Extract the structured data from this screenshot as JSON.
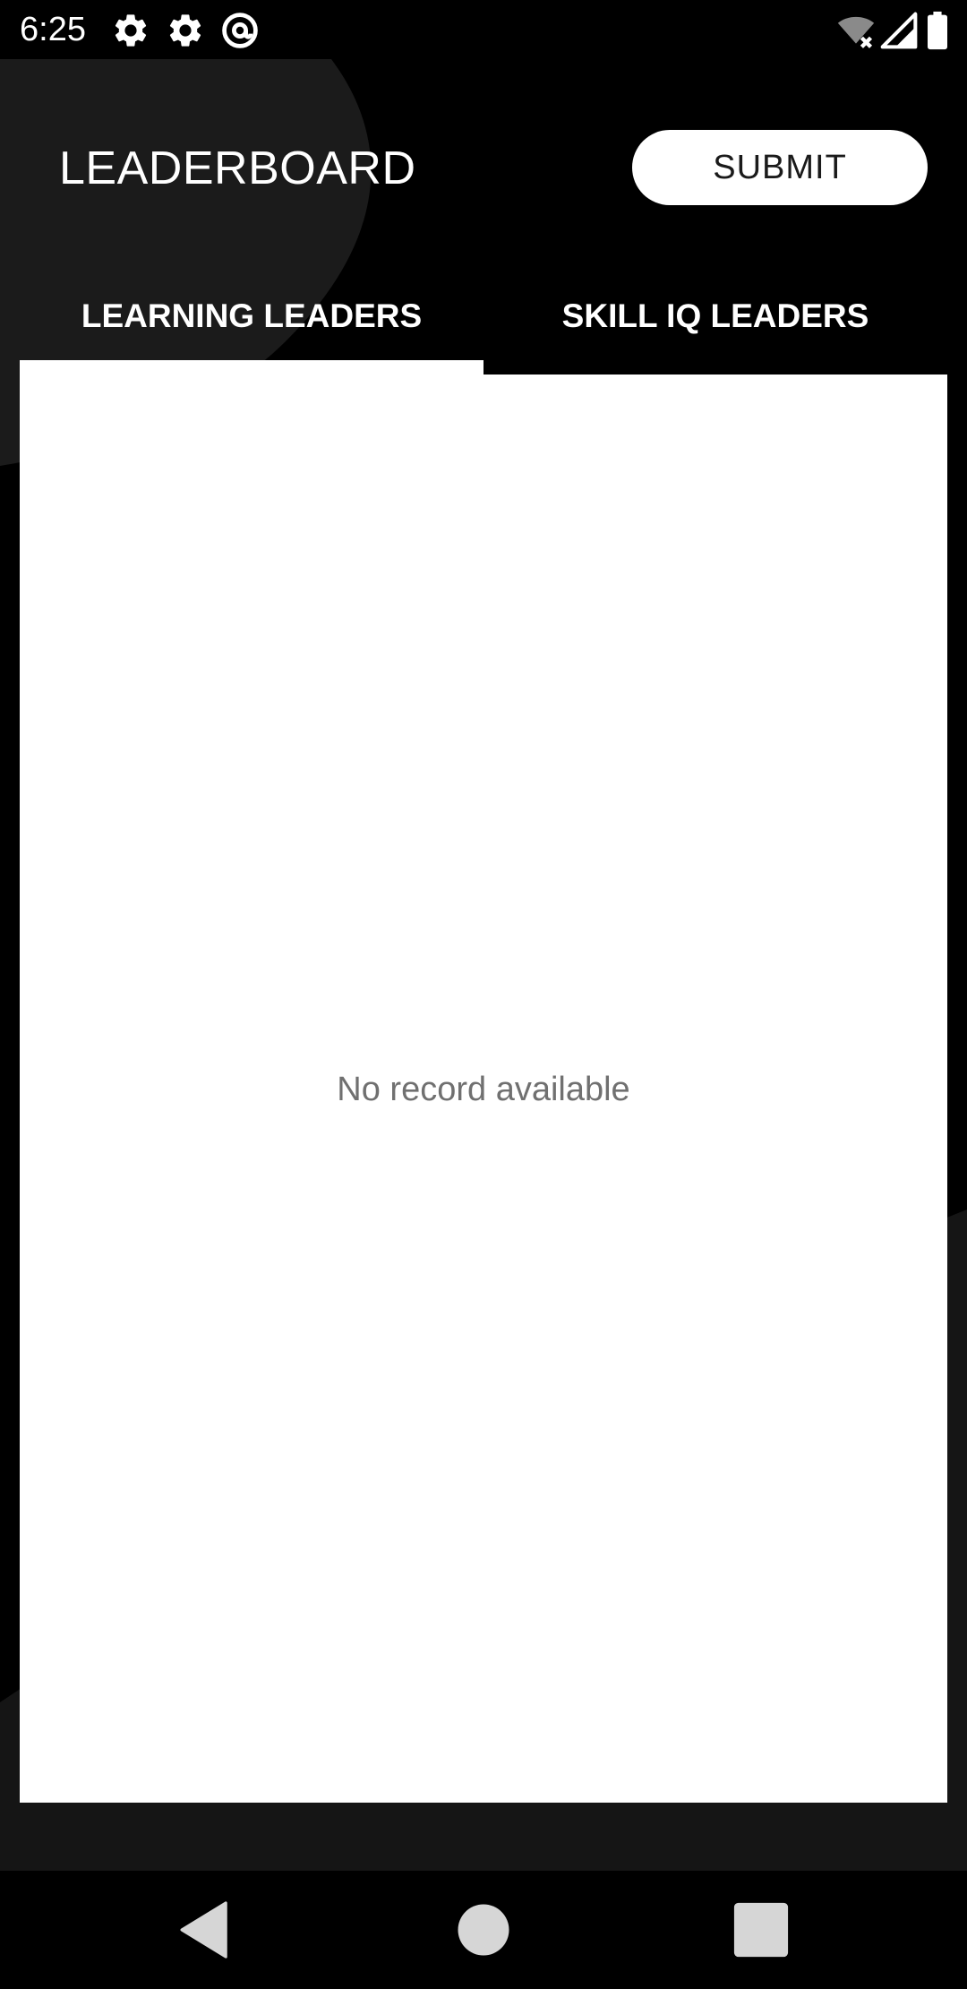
{
  "status_bar": {
    "time": "6:25",
    "icons_left": [
      "settings-icon",
      "settings-icon",
      "at-sign-icon"
    ],
    "icons_right": [
      "wifi-off-icon",
      "cellular-signal-icon",
      "battery-icon"
    ]
  },
  "header": {
    "title": "LEADERBOARD",
    "submit_label": "SUBMIT"
  },
  "tabs": [
    {
      "label": "LEARNING LEADERS",
      "selected": true
    },
    {
      "label": "SKILL IQ LEADERS",
      "selected": false
    }
  ],
  "content": {
    "empty_message": "No record available"
  },
  "nav_bar": {
    "buttons": [
      "back-icon",
      "home-icon",
      "recents-icon"
    ]
  },
  "colors": {
    "background": "#000000",
    "decorative_shape": "#1b1b1b",
    "card": "#ffffff",
    "muted_text": "#707070",
    "nav_icons": "#d6d6d6"
  }
}
